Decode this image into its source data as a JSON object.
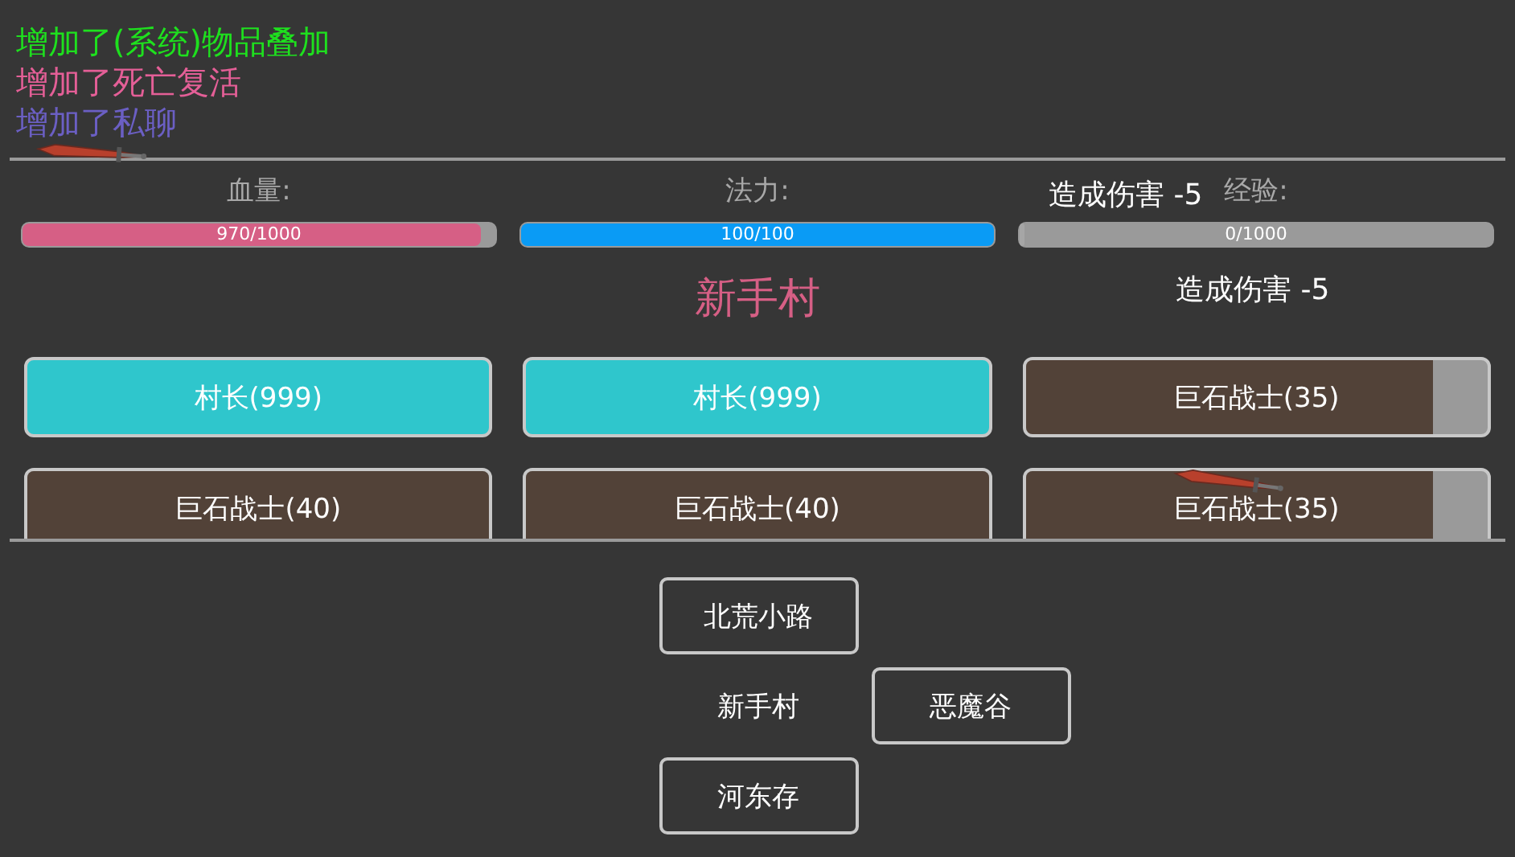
{
  "messages": [
    {
      "text": "增加了(系统)物品叠加",
      "color": "#1ee01e"
    },
    {
      "text": "增加了死亡复活",
      "color": "#e45f97"
    },
    {
      "text": "增加了私聊",
      "color": "#6b5fc4"
    }
  ],
  "stats": [
    {
      "label": "血量:",
      "reading": "970/1000",
      "level": 0.97,
      "color": "#d65f85"
    },
    {
      "label": "法力:",
      "reading": "100/100",
      "level": 1,
      "color": "#0a9bf5"
    },
    {
      "label": "经验:",
      "reading": "0/1000",
      "level": 0
    }
  ],
  "floating_texts": [
    "造成伤害 -5",
    "造成伤害 -5"
  ],
  "location": "新手村",
  "units": [
    {
      "kind": "npc",
      "name": "村长(999)"
    },
    {
      "kind": "npc",
      "name": "村长(999)"
    },
    {
      "kind": "monster",
      "name": "巨石战士(35)",
      "level": 0.88
    },
    {
      "kind": "monster",
      "name": "巨石战士(40)",
      "level": 1
    },
    {
      "kind": "monster",
      "name": "巨石战士(40)",
      "level": 1
    },
    {
      "kind": "monster",
      "name": "巨石战士(35)",
      "level": 0.88
    }
  ],
  "map": {
    "north": "北荒小路",
    "center": "新手村",
    "east": "恶魔谷",
    "south": "河东存"
  }
}
